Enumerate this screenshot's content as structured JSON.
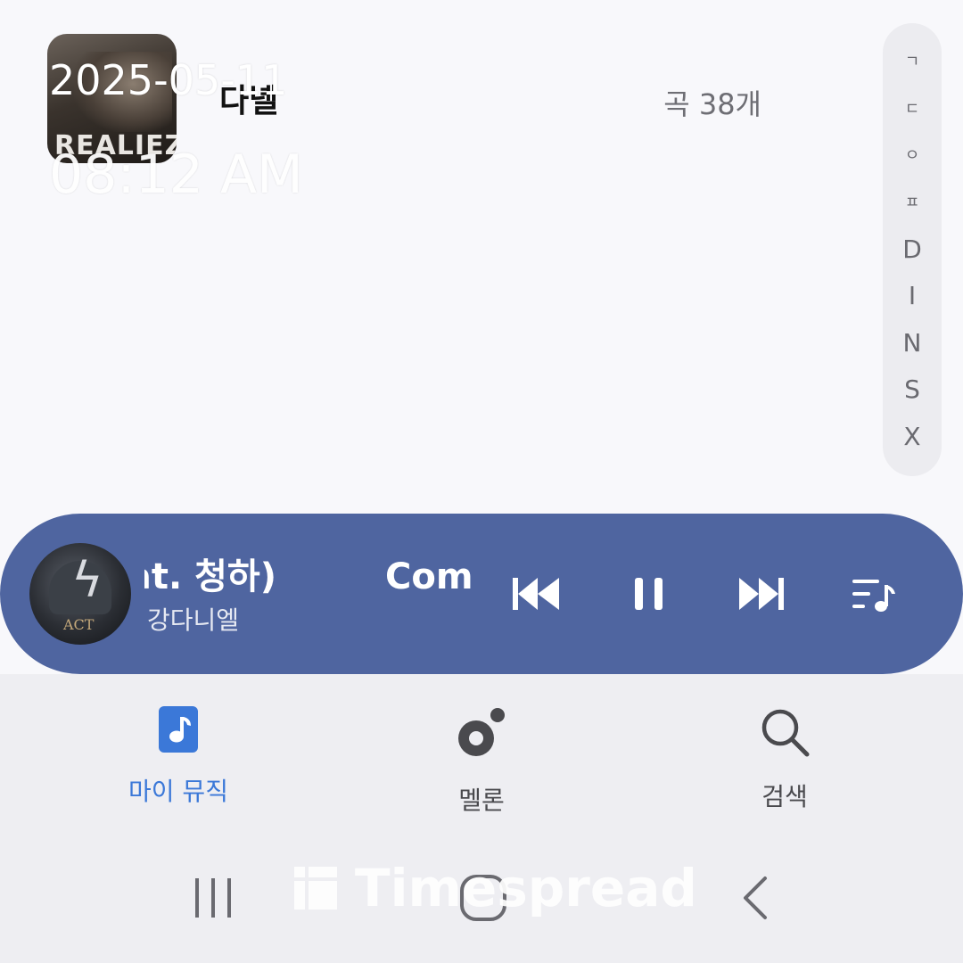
{
  "album": {
    "title": "다녤",
    "track_count": "곡 38개",
    "art_text": "REALIEZ"
  },
  "timestamp": {
    "date": "2025-05-11",
    "time": "08:12 AM"
  },
  "index_bar": [
    "ㄱ",
    "ㄷ",
    "ㅇ",
    "ㅍ",
    "D",
    "I",
    "N",
    "S",
    "X"
  ],
  "mini_player": {
    "title": "(feat. 청하)",
    "artist": "강다니엘",
    "title_next": "Come",
    "art_text": "ACT",
    "background": "#4f65a0"
  },
  "bottom_nav": [
    {
      "label": "마이 뮤직",
      "active": true,
      "color": "#3b78d8"
    },
    {
      "label": "멜론",
      "active": false,
      "color": "#4a4a4e"
    },
    {
      "label": "검색",
      "active": false,
      "color": "#4a4a4e"
    }
  ],
  "watermark": {
    "brand": "Timespread"
  }
}
